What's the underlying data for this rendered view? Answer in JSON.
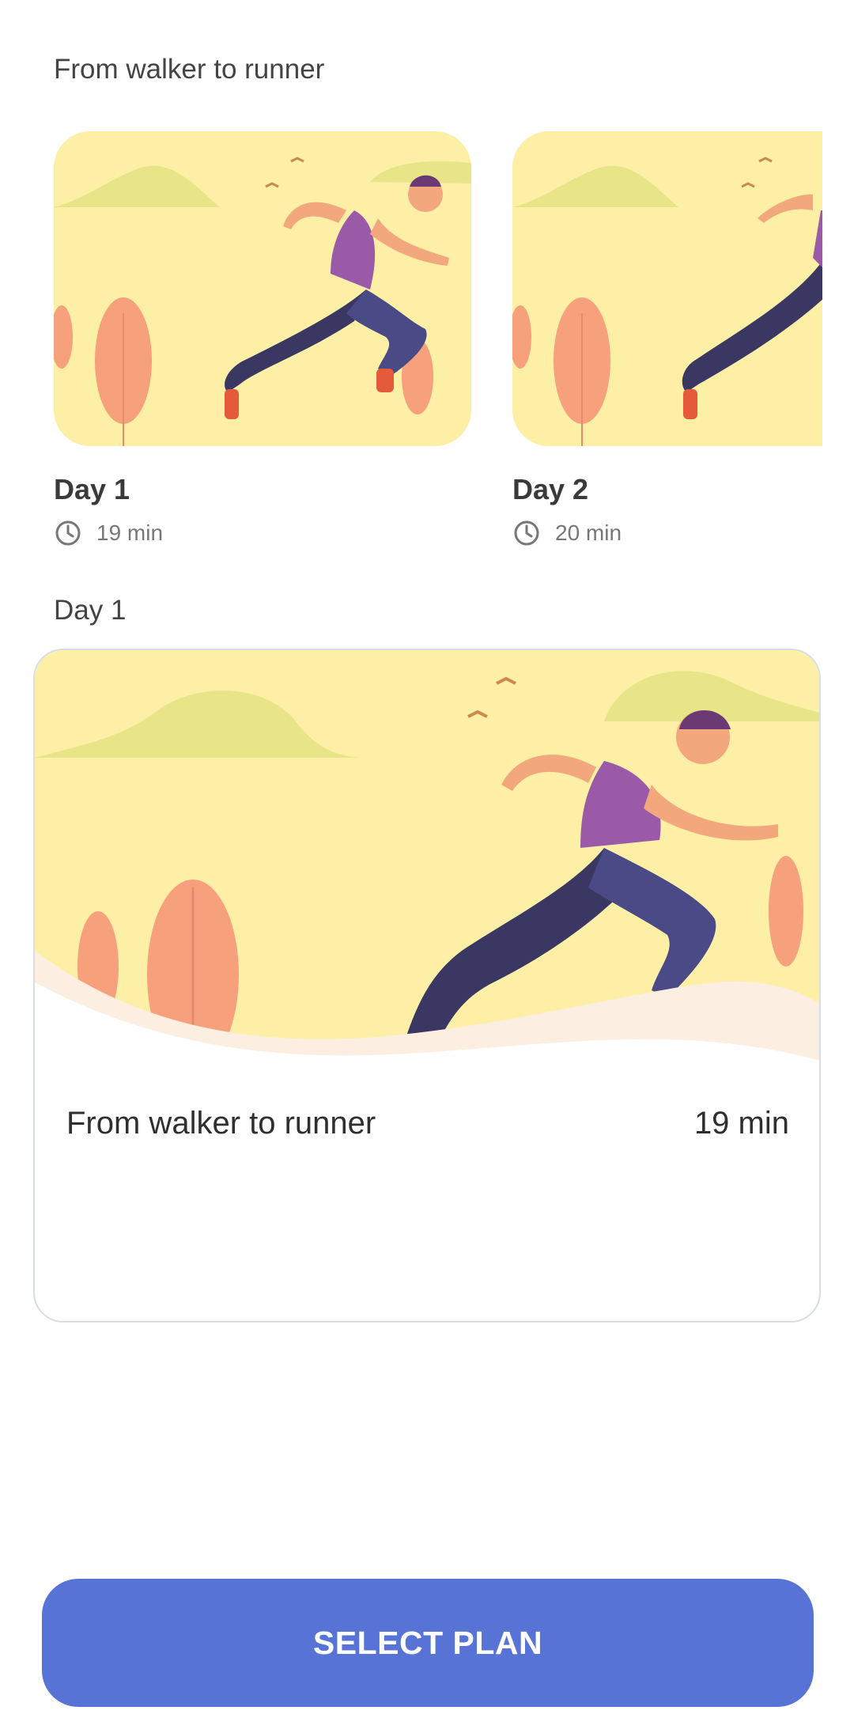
{
  "header": {
    "title": "From walker to runner"
  },
  "days": [
    {
      "label": "Day 1",
      "duration": "19 min"
    },
    {
      "label": "Day 2",
      "duration": "20 min"
    }
  ],
  "selected": {
    "section_label": "Day 1",
    "plan_name": "From walker to runner",
    "duration": "19 min"
  },
  "action": {
    "select_label": "SELECT PLAN"
  },
  "colors": {
    "accent": "#5873d6",
    "illustration_bg": "#fdf0a6",
    "tree": "#f6a07c",
    "tank_top": "#9a5aa8",
    "pants": "#3a3763"
  }
}
